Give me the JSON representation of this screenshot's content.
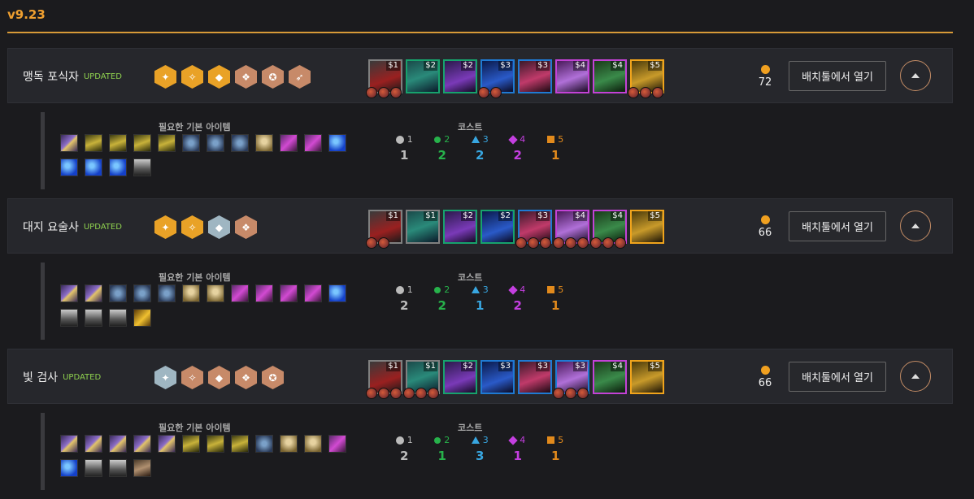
{
  "version": "v9.23",
  "open_label": "배치툴에서 열기",
  "detail_labels": {
    "base_items": "필요한 기본 아이템",
    "cost": "코스트"
  },
  "colors": {
    "tier1": "#bbbbbb",
    "tier2": "#27b24b",
    "tier3": "#38a6e0",
    "tier4": "#c43fe0",
    "tier5": "#e28a1c"
  },
  "comps": [
    {
      "name": "맹독 포식자",
      "updated": "UPDATED",
      "gold": "72",
      "traits": [
        "gold",
        "gold",
        "gold",
        "bronze",
        "bronze",
        "bronze"
      ],
      "champions": [
        {
          "cost": "$1",
          "tier": 1,
          "items": 3
        },
        {
          "cost": "$2",
          "tier": 2,
          "items": 0
        },
        {
          "cost": "$2",
          "tier": 2,
          "items": 0
        },
        {
          "cost": "$3",
          "tier": 3,
          "items": 2
        },
        {
          "cost": "$3",
          "tier": 3,
          "items": 0
        },
        {
          "cost": "$4",
          "tier": 4,
          "items": 0
        },
        {
          "cost": "$4",
          "tier": 4,
          "items": 0
        },
        {
          "cost": "$5",
          "tier": 5,
          "items": 3
        }
      ],
      "base_items": [
        "sword",
        "bow",
        "bow",
        "bow",
        "bow",
        "vest",
        "vest",
        "vest",
        "cloak",
        "rod",
        "rod",
        "tear",
        "tear",
        "tear",
        "tear",
        "belt"
      ],
      "cost_labels": [
        "1",
        "2",
        "3",
        "4",
        "5"
      ],
      "cost_values": [
        "1",
        "2",
        "2",
        "2",
        "1"
      ]
    },
    {
      "name": "대지 요술사",
      "updated": "UPDATED",
      "gold": "66",
      "traits": [
        "gold",
        "gold",
        "silver",
        "bronze"
      ],
      "champions": [
        {
          "cost": "$1",
          "tier": 1,
          "items": 2
        },
        {
          "cost": "$1",
          "tier": 1,
          "items": 0
        },
        {
          "cost": "$2",
          "tier": 2,
          "items": 0
        },
        {
          "cost": "$2",
          "tier": 2,
          "items": 0
        },
        {
          "cost": "$3",
          "tier": 3,
          "items": 3
        },
        {
          "cost": "$4",
          "tier": 4,
          "items": 3
        },
        {
          "cost": "$4",
          "tier": 4,
          "items": 3
        },
        {
          "cost": "$5",
          "tier": 5,
          "items": 0
        }
      ],
      "base_items": [
        "sword",
        "sword",
        "vest",
        "vest",
        "vest",
        "cloak",
        "cloak",
        "rod",
        "rod",
        "rod",
        "rod",
        "tear",
        "belt",
        "belt",
        "belt",
        "spat"
      ],
      "cost_labels": [
        "1",
        "2",
        "3",
        "4",
        "5"
      ],
      "cost_values": [
        "2",
        "2",
        "1",
        "2",
        "1"
      ]
    },
    {
      "name": "빛 검사",
      "updated": "UPDATED",
      "gold": "66",
      "traits": [
        "silver",
        "bronze",
        "bronze",
        "bronze",
        "bronze"
      ],
      "champions": [
        {
          "cost": "$1",
          "tier": 1,
          "items": 3
        },
        {
          "cost": "$1",
          "tier": 1,
          "items": 3
        },
        {
          "cost": "$2",
          "tier": 2,
          "items": 0
        },
        {
          "cost": "$3",
          "tier": 3,
          "items": 0
        },
        {
          "cost": "$3",
          "tier": 3,
          "items": 0
        },
        {
          "cost": "$3",
          "tier": 3,
          "items": 3
        },
        {
          "cost": "$4",
          "tier": 4,
          "items": 0
        },
        {
          "cost": "$5",
          "tier": 5,
          "items": 0
        }
      ],
      "base_items": [
        "sword",
        "sword",
        "sword",
        "sword",
        "sword",
        "bow",
        "bow",
        "bow",
        "vest",
        "cloak",
        "cloak",
        "rod",
        "tear",
        "belt",
        "belt",
        "glove"
      ],
      "cost_labels": [
        "1",
        "2",
        "3",
        "4",
        "5"
      ],
      "cost_values": [
        "2",
        "1",
        "3",
        "1",
        "1"
      ]
    }
  ]
}
